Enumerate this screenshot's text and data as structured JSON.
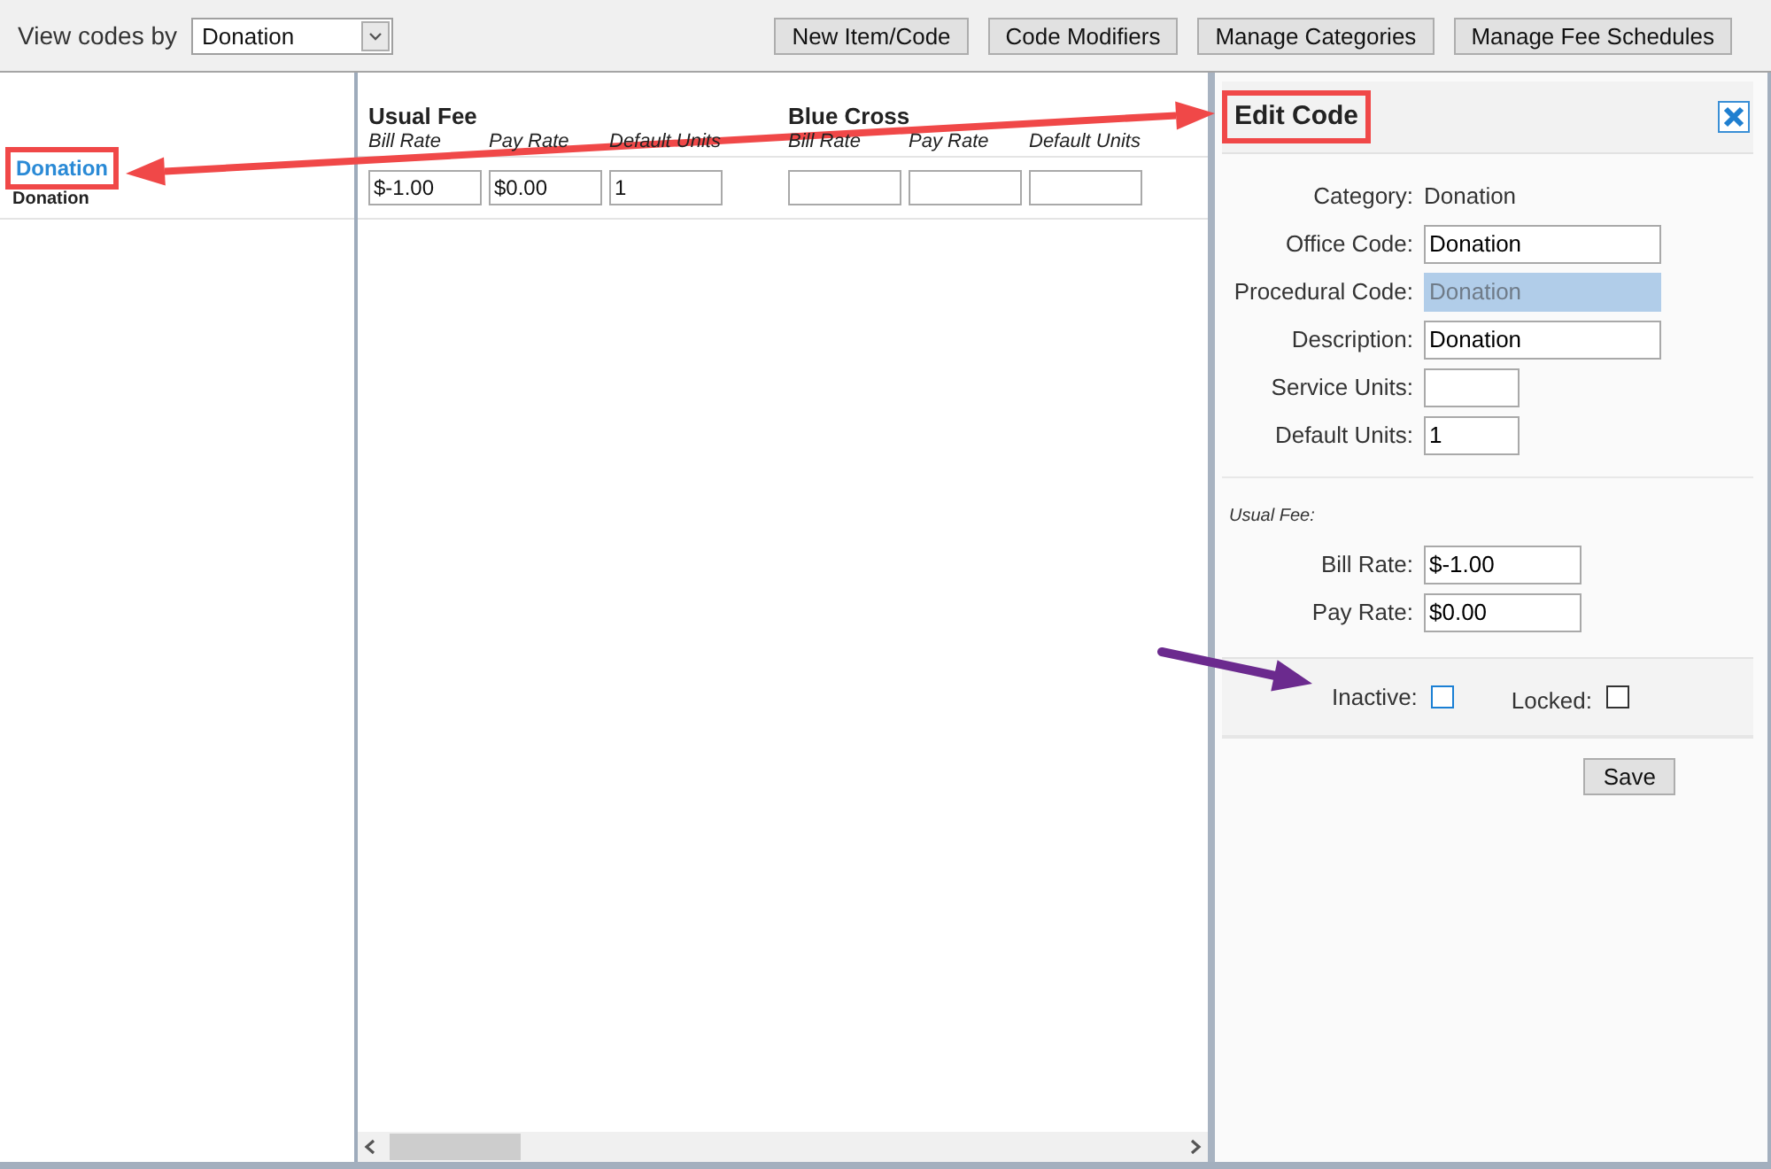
{
  "toolbar": {
    "view_label": "View codes by",
    "view_select": {
      "value": "Donation"
    },
    "buttons": [
      "New Item/Code",
      "Code Modifiers",
      "Manage Categories",
      "Manage Fee Schedules"
    ]
  },
  "code_list": [
    {
      "name": "Donation",
      "subtitle": "Donation",
      "highlighted": true
    }
  ],
  "fee_grid": {
    "groups": [
      {
        "title": "Usual Fee",
        "columns": [
          {
            "label": "Bill Rate",
            "value": "$-1.00"
          },
          {
            "label": "Pay Rate",
            "value": "$0.00"
          },
          {
            "label": "Default Units",
            "value": "1"
          }
        ]
      },
      {
        "title": "Blue Cross",
        "columns": [
          {
            "label": "Bill Rate"
          },
          {
            "label": "Pay Rate"
          },
          {
            "label": "Default Units"
          }
        ]
      }
    ]
  },
  "edit_panel": {
    "title": "Edit Code",
    "highlighted": true,
    "fields": [
      {
        "kind": "text",
        "label": "Category:",
        "value": "Donation",
        "disabled": false
      },
      {
        "kind": "input",
        "label": "Office Code:",
        "value": "Donation",
        "disabled": false
      },
      {
        "kind": "input",
        "label": "Procedural Code:",
        "value": "Donation",
        "disabled": true
      },
      {
        "kind": "input",
        "label": "Description:",
        "value": "Donation",
        "disabled": false
      },
      {
        "kind": "short_input",
        "label": "Service Units:",
        "disabled": false
      },
      {
        "kind": "short_input",
        "label": "Default Units:",
        "value": "1",
        "disabled": false
      }
    ],
    "fee_section": {
      "title": "Usual Fee:",
      "fields": [
        {
          "label": "Bill Rate:",
          "value": "$-1.00"
        },
        {
          "label": "Pay Rate:",
          "value": "$0.00"
        }
      ]
    },
    "flags": [
      {
        "label": "Inactive:",
        "checked": false,
        "focused": true
      },
      {
        "label": "Locked:",
        "checked": false,
        "focused": false
      }
    ],
    "save_button": "Save"
  }
}
